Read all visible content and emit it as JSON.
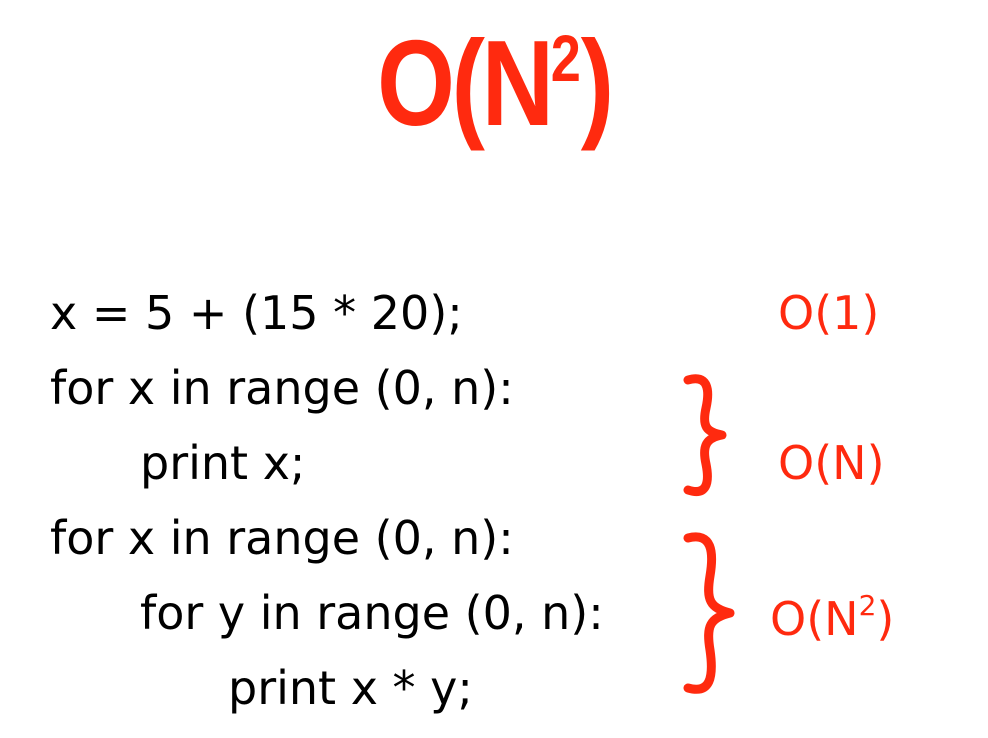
{
  "title": {
    "base": "O(N",
    "exponent": "2",
    "close": ")"
  },
  "code": {
    "line1": "x = 5 + (15 * 20);",
    "line2": "for x in range (0, n):",
    "line3": "print x;",
    "line4": "for x in range (0, n):",
    "line5": "for y in range (0, n):",
    "line6": "print x * y;"
  },
  "annotations": {
    "constant": "O(1)",
    "linear": "O(N)",
    "quadratic_base": "O(N",
    "quadratic_exponent": "2",
    "quadratic_close": ")"
  },
  "colors": {
    "accent": "#ff2a0f",
    "code_text": "#000000",
    "background": "#ffffff"
  }
}
